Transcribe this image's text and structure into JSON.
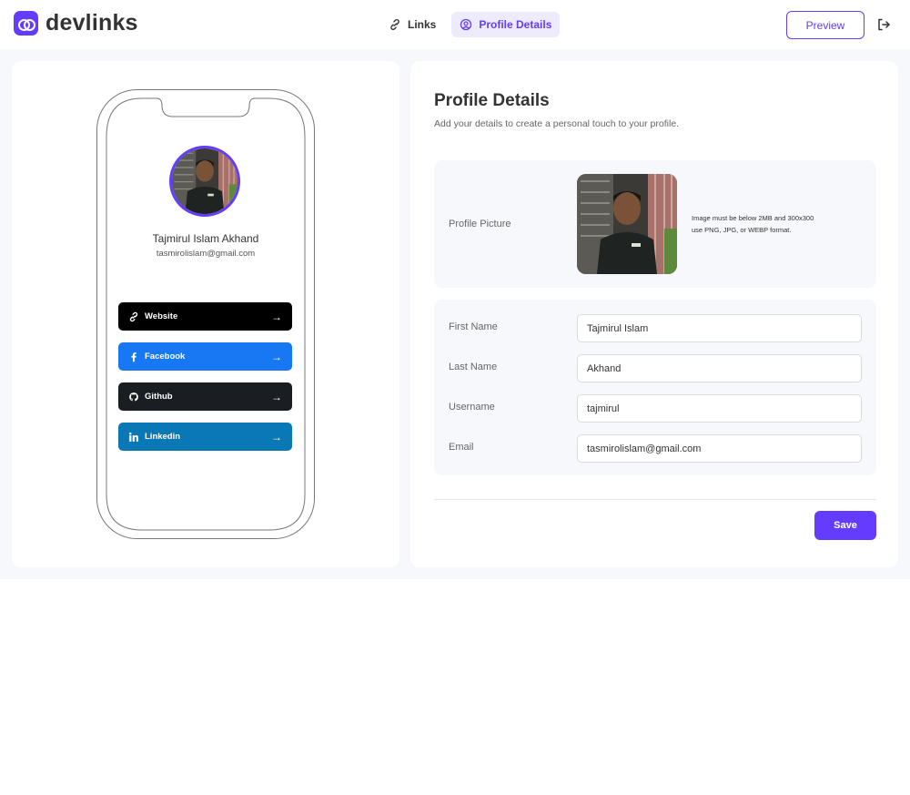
{
  "app": {
    "name": "devlinks"
  },
  "nav": {
    "links_label": "Links",
    "profile_label": "Profile Details"
  },
  "header": {
    "preview_label": "Preview"
  },
  "preview": {
    "name": "Tajmirul Islam Akhand",
    "email": "tasmirolislam@gmail.com",
    "links": [
      {
        "label": "Website",
        "icon": "link-icon",
        "color": "#000000"
      },
      {
        "label": "Facebook",
        "icon": "facebook-icon",
        "color": "#1877f2"
      },
      {
        "label": "Github",
        "icon": "github-icon",
        "color": "#1a1d21"
      },
      {
        "label": "Linkedin",
        "icon": "linkedin-icon",
        "color": "#0a78b5"
      }
    ]
  },
  "profile": {
    "title": "Profile Details",
    "subtitle": "Add your details to create a personal touch to your profile.",
    "picture_label": "Profile Picture",
    "picture_hint_line1": "Image must be below 2MB and 300x300",
    "picture_hint_line2": "use PNG, JPG, or WEBP format.",
    "fields": [
      {
        "label": "First Name",
        "value": "Tajmirul Islam"
      },
      {
        "label": "Last Name",
        "value": "Akhand"
      },
      {
        "label": "Username",
        "value": "tajmirul"
      },
      {
        "label": "Email",
        "value": "tasmirolislam@gmail.com"
      }
    ],
    "save_label": "Save"
  },
  "colors": {
    "accent": "#633cff",
    "accent_light": "#efebff",
    "background": "#f6f8fc"
  }
}
